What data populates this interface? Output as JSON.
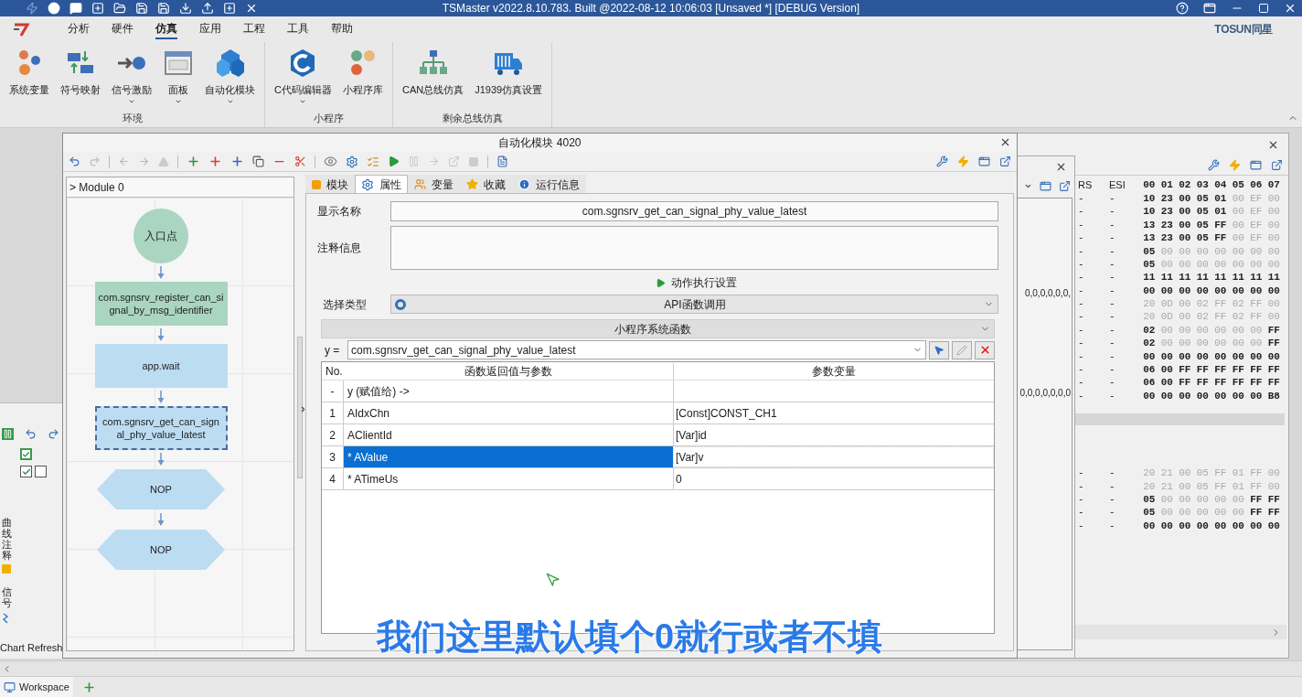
{
  "title_bar": {
    "title": "TSMaster v2022.8.10.783. Built @2022-08-12 10:06:03 [Unsaved *] [DEBUG Version]"
  },
  "menu": [
    {
      "label": "分析",
      "selected": false
    },
    {
      "label": "硬件",
      "selected": false
    },
    {
      "label": "仿真",
      "selected": true
    },
    {
      "label": "应用",
      "selected": false
    },
    {
      "label": "工程",
      "selected": false
    },
    {
      "label": "工具",
      "selected": false
    },
    {
      "label": "帮助",
      "selected": false
    }
  ],
  "brand": "TOSUN同星",
  "ribbon_groups": [
    {
      "label": "环境",
      "buttons": [
        {
          "label": "系统变量",
          "dropdown": false
        },
        {
          "label": "符号映射",
          "dropdown": false
        },
        {
          "label": "信号激励",
          "dropdown": true
        },
        {
          "label": "面板",
          "dropdown": true
        },
        {
          "label": "自动化模块",
          "dropdown": true
        }
      ]
    },
    {
      "label": "小程序",
      "buttons": [
        {
          "label": "C代码编辑器",
          "dropdown": true
        },
        {
          "label": "小程序库",
          "dropdown": false
        }
      ]
    },
    {
      "label": "剩余总线仿真",
      "buttons": [
        {
          "label": "CAN总线仿真",
          "dropdown": false
        },
        {
          "label": "J1939仿真设置",
          "dropdown": false
        }
      ]
    }
  ],
  "automation_window": {
    "title": "自动化模块 4020",
    "tree_path": "> Module 0",
    "nodes": [
      {
        "kind": "start",
        "label": "入口点",
        "color": "#a9d5c1",
        "selected": false
      },
      {
        "kind": "action",
        "label": "com.sgnsrv_register_can_signal_by_msg_identifier",
        "color": "#a9d5c1",
        "selected": false
      },
      {
        "kind": "action",
        "label": "app.wait",
        "color": "#bcdcf2",
        "selected": false
      },
      {
        "kind": "action",
        "label": "com.sgnsrv_get_can_signal_phy_value_latest",
        "color": "#bcdcf2",
        "selected": true
      },
      {
        "kind": "nop",
        "label": "NOP",
        "color": "#bcdcf2",
        "selected": false
      },
      {
        "kind": "nop",
        "label": "NOP",
        "color": "#bcdcf2",
        "selected": false
      }
    ],
    "tabs": [
      {
        "label": "模块",
        "selected": false
      },
      {
        "label": "属性",
        "selected": true
      },
      {
        "label": "变量",
        "selected": false
      },
      {
        "label": "收藏",
        "selected": false
      },
      {
        "label": "运行信息",
        "selected": false
      }
    ],
    "display_name": {
      "label": "显示名称",
      "value": "com.sgnsrv_get_can_signal_phy_value_latest"
    },
    "comment": {
      "label": "注释信息"
    },
    "action_settings": "动作执行设置",
    "select_type": {
      "label": "选择类型",
      "value": "API函数调用"
    },
    "function_group": "小程序系统函数",
    "assign_label": "y =",
    "function": "com.sgnsrv_get_can_signal_phy_value_latest",
    "table": {
      "columns": [
        "No.",
        "函数返回值与参数",
        "参数变量"
      ],
      "rows": [
        {
          "no": "-",
          "param": "y (赋值给) ->",
          "selected": false
        },
        {
          "no": "1",
          "param": "AIdxChn",
          "var": "[Const]CONST_CH1",
          "selected": false
        },
        {
          "no": "2",
          "param": "AClientId",
          "var": "[Var]id",
          "selected": false
        },
        {
          "no": "3",
          "param": "* AValue",
          "var": "[Var]v",
          "selected": true
        },
        {
          "no": "4",
          "param": "* ATimeUs",
          "var": "0",
          "selected": false
        }
      ]
    }
  },
  "side_window": {
    "lines": [
      "0,0,0,0,0,0,",
      "0,0,0,0,0,0,0"
    ]
  },
  "can_window": {
    "columns": [
      "RS",
      "ESI"
    ],
    "byte_columns": [
      "00",
      "01",
      "02",
      "03",
      "04",
      "05",
      "06",
      "07"
    ],
    "blocks": [
      {
        "rows": [
          {
            "rs": "-",
            "esi": "-",
            "bytes": [
              "10",
              "23",
              "00",
              "05",
              "01",
              "00",
              "EF",
              "00"
            ],
            "dim": [
              false,
              false,
              false,
              false,
              false,
              true,
              true,
              true
            ]
          },
          {
            "rs": "-",
            "esi": "-",
            "bytes": [
              "10",
              "23",
              "00",
              "05",
              "01",
              "00",
              "EF",
              "00"
            ],
            "dim": [
              false,
              false,
              false,
              false,
              false,
              true,
              true,
              true
            ]
          },
          {
            "rs": "-",
            "esi": "-",
            "bytes": [
              "13",
              "23",
              "00",
              "05",
              "FF",
              "00",
              "EF",
              "00"
            ],
            "dim": [
              false,
              false,
              false,
              false,
              false,
              true,
              true,
              true
            ]
          },
          {
            "rs": "-",
            "esi": "-",
            "bytes": [
              "13",
              "23",
              "00",
              "05",
              "FF",
              "00",
              "EF",
              "00"
            ],
            "dim": [
              false,
              false,
              false,
              false,
              false,
              true,
              true,
              true
            ]
          },
          {
            "rs": "-",
            "esi": "-",
            "bytes": [
              "05",
              "00",
              "00",
              "00",
              "00",
              "00",
              "00",
              "00"
            ],
            "dim": [
              false,
              true,
              true,
              true,
              true,
              true,
              true,
              true
            ]
          },
          {
            "rs": "-",
            "esi": "-",
            "bytes": [
              "05",
              "00",
              "00",
              "00",
              "00",
              "00",
              "00",
              "00"
            ],
            "dim": [
              false,
              true,
              true,
              true,
              true,
              true,
              true,
              true
            ]
          },
          {
            "rs": "-",
            "esi": "-",
            "bytes": [
              "11",
              "11",
              "11",
              "11",
              "11",
              "11",
              "11",
              "11"
            ],
            "dim": [
              false,
              false,
              false,
              false,
              false,
              false,
              false,
              false
            ]
          },
          {
            "rs": "-",
            "esi": "-",
            "bytes": [
              "00",
              "00",
              "00",
              "00",
              "00",
              "00",
              "00",
              "00"
            ],
            "dim": [
              false,
              false,
              false,
              false,
              false,
              false,
              false,
              false
            ]
          },
          {
            "rs": "-",
            "esi": "-",
            "bytes": [
              "20",
              "0D",
              "00",
              "02",
              "FF",
              "02",
              "FF",
              "00"
            ],
            "dim": [
              true,
              true,
              true,
              true,
              true,
              true,
              true,
              true
            ]
          },
          {
            "rs": "-",
            "esi": "-",
            "bytes": [
              "20",
              "0D",
              "00",
              "02",
              "FF",
              "02",
              "FF",
              "00"
            ],
            "dim": [
              true,
              true,
              true,
              true,
              true,
              true,
              true,
              true
            ]
          },
          {
            "rs": "-",
            "esi": "-",
            "bytes": [
              "02",
              "00",
              "00",
              "00",
              "00",
              "00",
              "00",
              "FF"
            ],
            "dim": [
              false,
              true,
              true,
              true,
              true,
              true,
              true,
              false
            ]
          },
          {
            "rs": "-",
            "esi": "-",
            "bytes": [
              "02",
              "00",
              "00",
              "00",
              "00",
              "00",
              "00",
              "FF"
            ],
            "dim": [
              false,
              true,
              true,
              true,
              true,
              true,
              true,
              false
            ]
          },
          {
            "rs": "-",
            "esi": "-",
            "bytes": [
              "00",
              "00",
              "00",
              "00",
              "00",
              "00",
              "00",
              "00"
            ],
            "dim": [
              false,
              false,
              false,
              false,
              false,
              false,
              false,
              false
            ]
          },
          {
            "rs": "-",
            "esi": "-",
            "bytes": [
              "06",
              "00",
              "FF",
              "FF",
              "FF",
              "FF",
              "FF",
              "FF"
            ],
            "dim": [
              false,
              false,
              false,
              false,
              false,
              false,
              false,
              false
            ]
          },
          {
            "rs": "-",
            "esi": "-",
            "bytes": [
              "06",
              "00",
              "FF",
              "FF",
              "FF",
              "FF",
              "FF",
              "FF"
            ],
            "dim": [
              false,
              false,
              false,
              false,
              false,
              false,
              false,
              false
            ]
          },
          {
            "rs": "-",
            "esi": "-",
            "bytes": [
              "00",
              "00",
              "00",
              "00",
              "00",
              "00",
              "00",
              "B8"
            ],
            "dim": [
              false,
              false,
              false,
              false,
              false,
              false,
              false,
              false
            ]
          }
        ]
      },
      {
        "rows": [
          {
            "rs": "-",
            "esi": "-",
            "bytes": [
              "20",
              "21",
              "00",
              "05",
              "FF",
              "01",
              "FF",
              "00"
            ],
            "dim": [
              true,
              true,
              true,
              true,
              true,
              true,
              true,
              true
            ]
          },
          {
            "rs": "-",
            "esi": "-",
            "bytes": [
              "20",
              "21",
              "00",
              "05",
              "FF",
              "01",
              "FF",
              "00"
            ],
            "dim": [
              true,
              true,
              true,
              true,
              true,
              true,
              true,
              true
            ]
          },
          {
            "rs": "-",
            "esi": "-",
            "bytes": [
              "05",
              "00",
              "00",
              "00",
              "00",
              "00",
              "FF",
              "FF"
            ],
            "dim": [
              false,
              true,
              true,
              true,
              true,
              true,
              false,
              false
            ]
          },
          {
            "rs": "-",
            "esi": "-",
            "bytes": [
              "05",
              "00",
              "00",
              "00",
              "00",
              "00",
              "FF",
              "FF"
            ],
            "dim": [
              false,
              true,
              true,
              true,
              true,
              true,
              false,
              false
            ]
          },
          {
            "rs": "-",
            "esi": "-",
            "bytes": [
              "00",
              "00",
              "00",
              "00",
              "00",
              "00",
              "00",
              "00"
            ],
            "dim": [
              false,
              false,
              false,
              false,
              false,
              false,
              false,
              false
            ]
          }
        ]
      }
    ]
  },
  "left_panel": {
    "check_rows": [
      {
        "checks": [
          true
        ]
      },
      {
        "checks": [
          true,
          false
        ]
      }
    ],
    "side_tabs": [
      "曲线注释",
      "信号"
    ],
    "footer": "Chart Refresh"
  },
  "subtitle": "我们这里默认填个0就行或者不填",
  "workspace_tabs": [
    {
      "label": "Workspace",
      "selected": true
    }
  ]
}
